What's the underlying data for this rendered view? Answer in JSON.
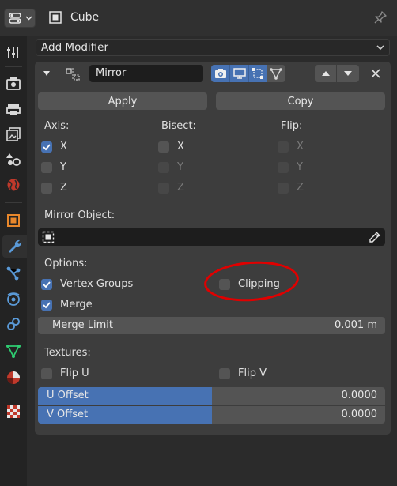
{
  "header": {
    "object_name": "Cube"
  },
  "add_modifier": {
    "label": "Add Modifier"
  },
  "modifier": {
    "name": "Mirror",
    "apply_label": "Apply",
    "copy_label": "Copy",
    "axis": {
      "title": "Axis:",
      "x": "X",
      "y": "Y",
      "z": "Z",
      "x_checked": true,
      "y_checked": false,
      "z_checked": false
    },
    "bisect": {
      "title": "Bisect:",
      "x": "X",
      "y": "Y",
      "z": "Z"
    },
    "flip": {
      "title": "Flip:",
      "x": "X",
      "y": "Y",
      "z": "Z"
    },
    "mirror_object": {
      "title": "Mirror Object:",
      "value": ""
    },
    "options": {
      "title": "Options:",
      "vertex_groups": "Vertex Groups",
      "vertex_groups_checked": true,
      "clipping": "Clipping",
      "clipping_checked": false,
      "merge": "Merge",
      "merge_checked": true
    },
    "merge_limit": {
      "label": "Merge Limit",
      "value": "0.001 m"
    },
    "textures": {
      "title": "Textures:",
      "flip_u": "Flip U",
      "flip_v": "Flip V",
      "u_offset_label": "U Offset",
      "u_offset_value": "0.0000",
      "v_offset_label": "V Offset",
      "v_offset_value": "0.0000",
      "offset_fill_fraction": 0.5
    }
  },
  "colors": {
    "accent": "#4772b3",
    "annotation": "#e00000"
  }
}
